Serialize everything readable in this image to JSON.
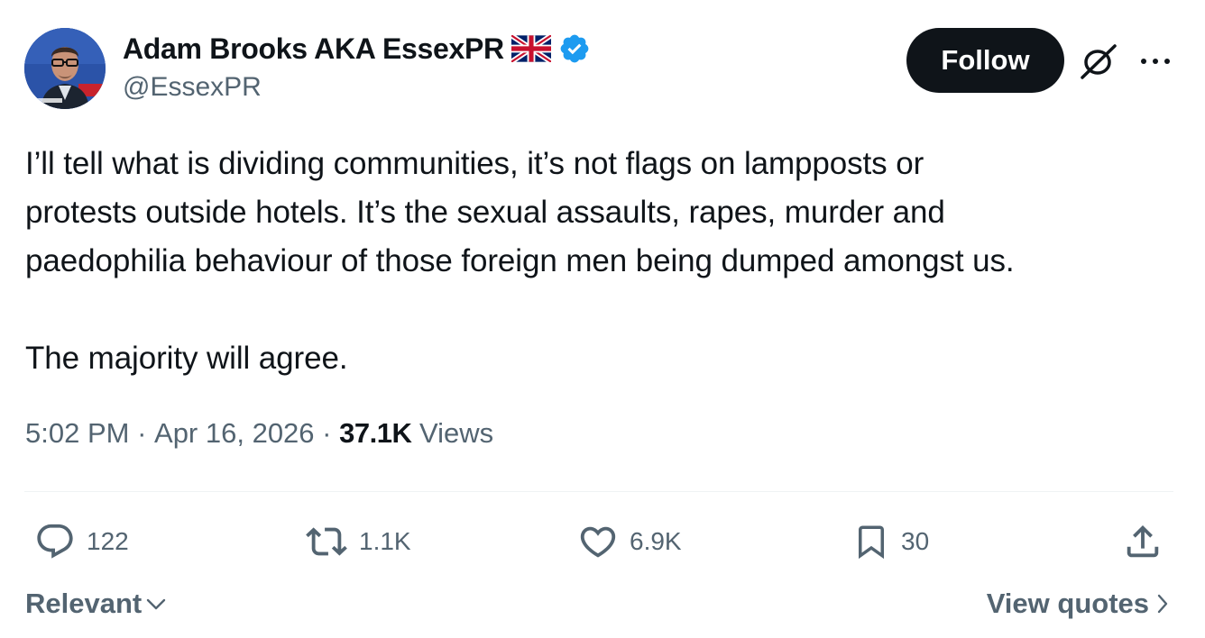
{
  "author": {
    "display_name": "Adam Brooks AKA EssexPR",
    "handle": "@EssexPR",
    "flag": "uk-flag-icon",
    "verified": true,
    "verified_color": "#1d9bf0"
  },
  "header": {
    "follow_label": "Follow",
    "grok_icon": "grok-icon",
    "more_icon": "more-icon"
  },
  "tweet": {
    "lines": [
      "I’ll tell what is dividing communities, it’s not flags on lampposts or",
      "protests outside hotels. It’s the sexual assaults, rapes, murder and",
      "paedophilia behaviour of those foreign men being dumped amongst us."
    ],
    "closing": "The majority will agree."
  },
  "meta": {
    "time": "5:02 PM",
    "separator": " · ",
    "date": "Apr 16, 2026",
    "views_count": "37.1K",
    "views_label": " Views"
  },
  "actions": {
    "replies": "122",
    "reposts": "1.1K",
    "likes": "6.9K",
    "bookmarks": "30"
  },
  "footer": {
    "sort_label": "Relevant",
    "view_quotes_label": "View quotes"
  },
  "colors": {
    "text_primary": "#0f1419",
    "text_secondary": "#536471",
    "divider": "#eff3f4",
    "follow_bg": "#0f1419"
  }
}
